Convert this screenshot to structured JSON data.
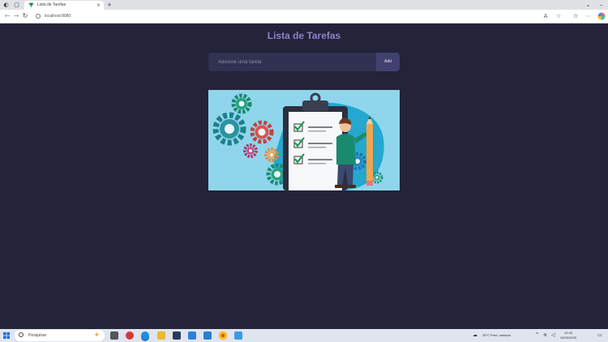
{
  "browser": {
    "tab_title": "Lista de Tarefas",
    "tab_close": "×",
    "new_tab": "+",
    "url": "localhost:8080",
    "window_buttons": {
      "menu": "⌄",
      "minimize": "–"
    }
  },
  "app": {
    "title": "Lista de Tarefas",
    "input_placeholder": "Adicione uma tarefa",
    "add_button_label": "Add",
    "illustration_bg": "#8fd6ec"
  },
  "colors": {
    "page_bg": "#23233a",
    "title": "#8e82c8",
    "input_bg": "#313152",
    "button_bg": "#414170",
    "accent_green": "#1a8a6e"
  },
  "taskbar": {
    "search_placeholder": "Pesquisar",
    "weather": "25°C  Pred. nublado",
    "time": "10:28",
    "date": "24/09/2025",
    "lang": "POR PTB2"
  }
}
